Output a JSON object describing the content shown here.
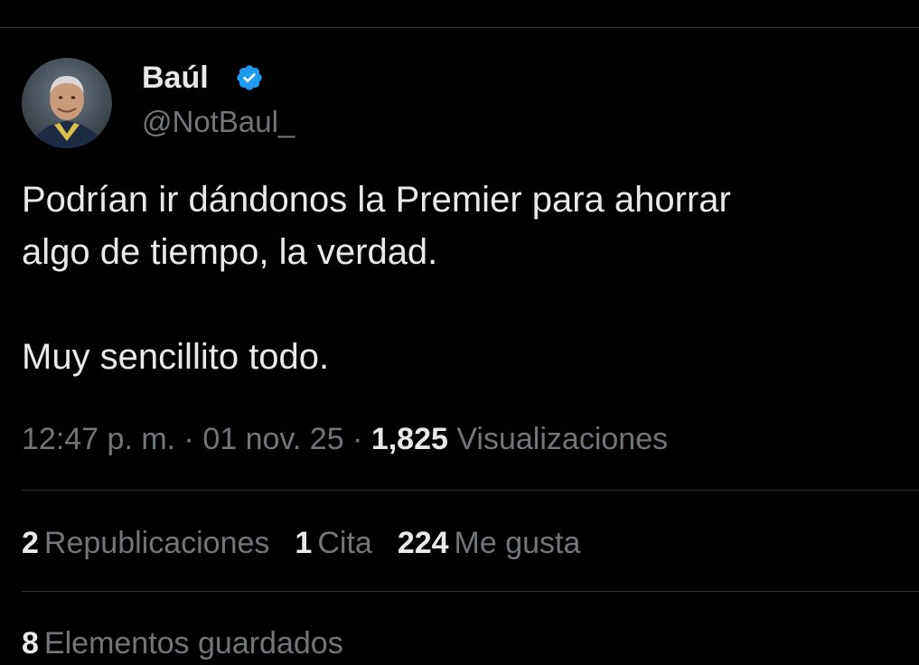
{
  "author": {
    "name": "Baúl",
    "handle": "@NotBaul_",
    "verified_color": "#1d9bf0"
  },
  "tweet": {
    "text": "Podrían ir dándonos la Premier para ahorrar\nalgo de tiempo, la verdad.\n\nMuy sencillito todo."
  },
  "meta": {
    "time": "12:47 p. m.",
    "sep1": " · ",
    "date": "01 nov. 25",
    "sep2": " · ",
    "views_count": "1,825",
    "views_label": " Visualizaciones"
  },
  "stats": {
    "reposts_count": "2",
    "reposts_label": "Republicaciones",
    "quotes_count": "1",
    "quotes_label": "Cita",
    "likes_count": "224",
    "likes_label": "Me gusta"
  },
  "bookmarks": {
    "count": "8",
    "label": "Elementos guardados"
  },
  "colors": {
    "background": "#000000",
    "primary_text": "#e7e9ea",
    "secondary_text": "#71767b",
    "divider": "#2f3336",
    "accent": "#1d9bf0"
  },
  "icons": {
    "verified": "verified-badge-icon",
    "avatar": "profile-photo"
  }
}
